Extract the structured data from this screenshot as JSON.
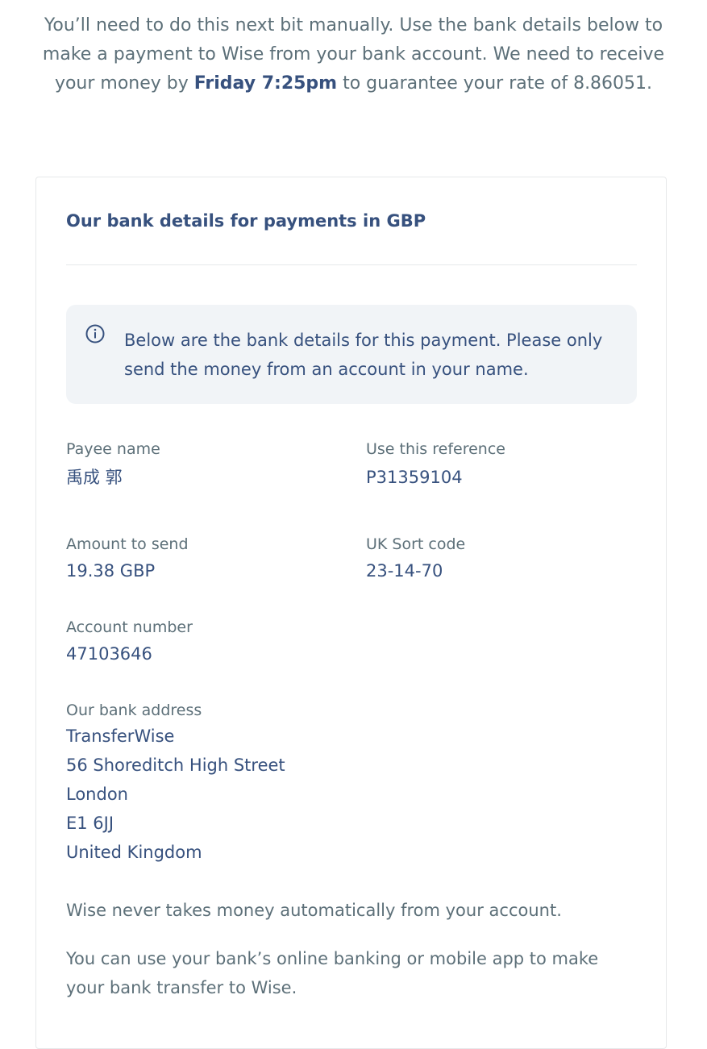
{
  "intro": {
    "before": "You’ll need to do this next bit manually. Use the bank details below to make a payment to Wise from your bank account. We need to receive your money by ",
    "deadline": "Friday 7:25pm",
    "after": " to guarantee your rate of 8.86051."
  },
  "card": {
    "title": "Our bank details for payments in GBP",
    "alert": {
      "icon": "info-icon",
      "text": "Below are the bank details for this payment. Please only send the money from an account in your name."
    },
    "fields": {
      "payee_name": {
        "label": "Payee name",
        "value": "禹成 郭"
      },
      "reference": {
        "label": "Use this reference",
        "value": "P31359104"
      },
      "amount": {
        "label": "Amount to send",
        "value": "19.38 GBP"
      },
      "sort_code": {
        "label": "UK Sort code",
        "value": "23-14-70"
      },
      "account_number": {
        "label": "Account number",
        "value": "47103646"
      }
    },
    "address": {
      "label": "Our bank address",
      "lines": [
        "TransferWise",
        "56 Shoreditch High Street",
        "London",
        "E1 6JJ",
        "United Kingdom"
      ]
    },
    "notes": [
      "Wise never takes money automatically from your account.",
      "You can use your bank’s online banking or mobile app to make your bank transfer to Wise."
    ]
  },
  "colors": {
    "heading": "#37517e",
    "muted": "#5d7079",
    "alert_bg": "#f1f4f7",
    "border": "#e6e8ea"
  }
}
